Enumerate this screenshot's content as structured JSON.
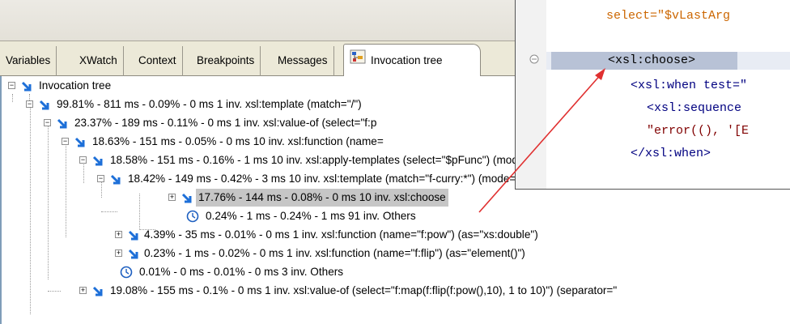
{
  "tabs": [
    {
      "label": "Variables",
      "active": false
    },
    {
      "label": "XWatch",
      "active": false
    },
    {
      "label": "Context",
      "active": false
    },
    {
      "label": "Breakpoints",
      "active": false
    },
    {
      "label": "Messages",
      "active": false
    },
    {
      "label": "Invocation tree",
      "active": true,
      "icon": "invocation-tree-icon"
    }
  ],
  "tree": {
    "rows": [
      {
        "label": "Invocation tree",
        "icon": "arrow-down-right-icon",
        "expander": "-"
      },
      {
        "label": "99.81% - 811 ms - 0.09% - 0 ms 1 inv. xsl:template (match=\"/\")",
        "icon": "arrow-down-right-icon",
        "expander": "-"
      },
      {
        "label": "23.37% - 189 ms - 0.11% - 0 ms 1 inv. xsl:value-of (select=\"f:p",
        "icon": "arrow-down-right-icon",
        "expander": "-"
      },
      {
        "label": "18.63% - 151 ms - 0.05% - 0 ms 10 inv. xsl:function (name=",
        "icon": "arrow-down-right-icon",
        "expander": "-"
      },
      {
        "label": "18.58% - 151 ms - 0.16% - 1 ms 10 inv. xsl:apply-templates (select=\"$pFunc\") (mode=\"f:FXSL\")",
        "icon": "arrow-down-right-icon",
        "expander": "-"
      },
      {
        "label": "18.42% - 149 ms - 0.42% - 3 ms 10 inv. xsl:template (match=\"f-curry:*\") (mode=\"f:FXSL\")",
        "icon": "arrow-down-right-icon",
        "expander": "-"
      },
      {
        "label": "17.76% - 144 ms - 0.08% - 0 ms 10 inv. xsl:choose",
        "icon": "arrow-down-right-icon",
        "expander": "+",
        "selected": true
      },
      {
        "label": "0.24% - 1 ms - 0.24% - 1 ms 91 inv. Others",
        "icon": "clock-icon",
        "expander": ""
      },
      {
        "label": "4.39% - 35 ms - 0.01% - 0 ms 1 inv. xsl:function (name=\"f:pow\") (as=\"xs:double\")",
        "icon": "arrow-down-right-icon",
        "expander": "+"
      },
      {
        "label": "0.23% - 1 ms - 0.02% - 0 ms 1 inv. xsl:function (name=\"f:flip\") (as=\"element()\")",
        "icon": "arrow-down-right-icon",
        "expander": "+"
      },
      {
        "label": "0.01% - 0 ms - 0.01% - 0 ms 3 inv. Others",
        "icon": "clock-icon",
        "expander": ""
      },
      {
        "label": "19.08% - 155 ms - 0.1% - 0 ms 1 inv. xsl:value-of (select=\"f:map(f:flip(f:pow(),10), 1 to 10)\") (separator=\"",
        "icon": "arrow-down-right-icon",
        "expander": "+"
      }
    ]
  },
  "popup": {
    "lines": [
      {
        "text": "select=\"$vLastArg",
        "color": "#cc6600"
      },
      {
        "text": "<xsl:choose>",
        "color": "#000000"
      },
      {
        "text": "<xsl:when test=\"",
        "tag": "<xsl:when ",
        "attr": "test=\"",
        "color": "#000080"
      },
      {
        "text": "<xsl:sequence",
        "color": "#000080"
      },
      {
        "text": "\"error((), '[E",
        "color": "#800000"
      },
      {
        "text": "</xsl:when>",
        "color": "#000080"
      }
    ]
  },
  "colors": {
    "selection": "#c6c6c6",
    "arrow": "#e03030",
    "icon_blue": "#1d6fd8"
  }
}
